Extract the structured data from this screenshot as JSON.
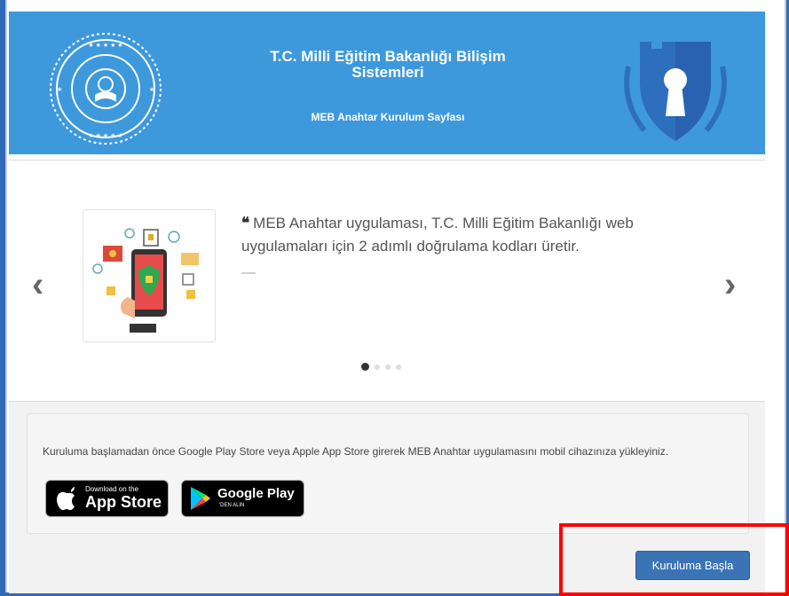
{
  "header": {
    "title": "T.C. Milli Eğitim Bakanlığı Bilişim Sistemleri",
    "subtitle": "MEB Anahtar Kurulum Sayfası"
  },
  "carousel": {
    "quote": "MEB Anahtar uygulaması, T.C. Milli Eğitim Bakanlığı web uygulamaları için 2 adımlı doğrulama kodları üretir.",
    "quote_mark": "❝",
    "dash": "—",
    "prev_icon": "‹",
    "next_icon": "›",
    "slide_count": 4,
    "active_slide": 1
  },
  "install": {
    "instructions": "Kuruluma başlamadan önce Google Play Store veya Apple App Store girerek MEB Anahtar uygulamasını mobil cihazınıza yükleyiniz.",
    "appstore_small": "Download on the",
    "appstore_big": "App Store",
    "googleplay_big": "Google Play",
    "googleplay_small": "'DEN ALIN",
    "start_button": "Kuruluma Başla"
  },
  "colors": {
    "header_bg": "#3e99dc",
    "button_bg": "#3a74b6",
    "highlight": "#ff0000"
  }
}
